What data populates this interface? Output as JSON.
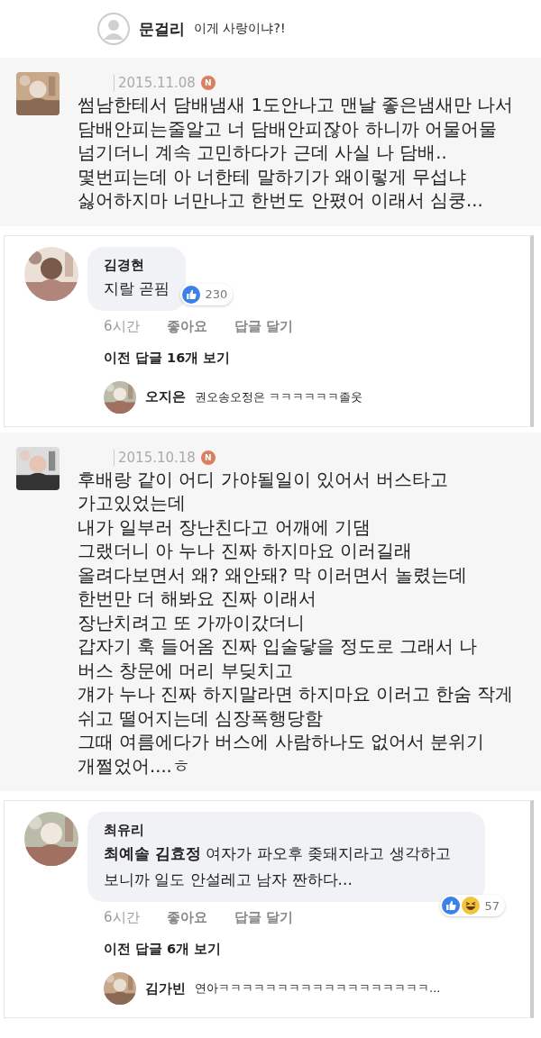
{
  "sections": [
    {
      "kind": "reply_line",
      "name": "문걸리",
      "text": "이게 사랑이냐?!"
    },
    {
      "kind": "cafe_post",
      "date": "2015.11.08",
      "badge": "N",
      "lines": [
        "썸남한테서 담배냄새 1도안나고 맨날 좋은냄새만 나서",
        "담배안피는줄알고 너 담배안피잖아 하니까 어물어물",
        "넘기더니 계속 고민하다가 근데 사실 나 담배..",
        "몇번피는데 아 너한테 말하기가 왜이렇게 무섭냐",
        "싫어하지마 너만나고 한번도 안폈어 이래서 심쿵..."
      ]
    },
    {
      "kind": "fb_comment",
      "name": "김경현",
      "text": "지랄 곧핌",
      "reactions": [
        {
          "kind": "like"
        }
      ],
      "count": "230",
      "time": "6시간",
      "like": "좋아요",
      "reply": "답글 달기",
      "more": "이전 답글 16개 보기",
      "sub": {
        "name": "오지은",
        "text": "권오송오정은 ㅋㅋㅋㅋㅋㅋ졸웃"
      }
    },
    {
      "kind": "cafe_post",
      "date": "2015.10.18",
      "badge": "N",
      "lines": [
        "후배랑 같이 어디 가야될일이 있어서 버스타고",
        "가고있었는데",
        "내가 일부러 장난친다고 어깨에 기댐",
        "그랬더니 아 누나 진짜 하지마요 이러길래",
        "올려다보면서 왜? 왜안돼? 막 이러면서 놀렸는데",
        "한번만 더 해봐요 진짜 이래서",
        "장난치려고 또 가까이갔더니",
        "갑자기 훅 들어옴 진짜 입술닿을 정도로 그래서 나",
        "버스 창문에 머리 부딪치고",
        "걔가 누나 진짜 하지말라면 하지마요 이러고 한숨 작게",
        "쉬고 떨어지는데 심장폭행당함",
        "그때 여름에다가 버스에 사람하나도 없어서 분위기",
        "개쩔었어....ㅎ"
      ]
    },
    {
      "kind": "fb_comment",
      "name": "최유리",
      "text": "**최예솔 김효정** 여자가 파오후 좆돼지라고 생각하고 보니까 일도 안설레고 남자 짠하다...",
      "reactions": [
        {
          "kind": "like"
        },
        {
          "kind": "haha"
        }
      ],
      "count": "57",
      "time": "6시간",
      "like": "좋아요",
      "reply": "답글 달기",
      "more": "이전 답글 6개 보기",
      "sub": {
        "name": "김가빈",
        "text": "연아ㅋㅋㅋㅋㅋㅋㅋㅋㅋㅋㅋㅋㅋㅋㅋㅋㅋㅋ..."
      }
    }
  ]
}
